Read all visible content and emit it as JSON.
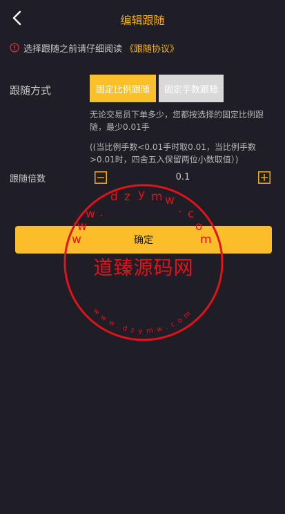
{
  "header": {
    "title": "编辑跟随",
    "back_icon": "chevron-left-icon"
  },
  "notice": {
    "icon": "warning-circle-icon",
    "text": "选择跟随之前请仔细阅读",
    "link": "《跟随协议》"
  },
  "follow_mode": {
    "label": "跟随方式",
    "options": [
      "固定比例跟随",
      "固定手数跟随"
    ],
    "selected": "固定比例跟随",
    "description": "无论交易员下单多少，您都按选择的固定比例跟随，最少0.01手",
    "note": "((当比例手数<0.01手时取0.01，当比例手数>0.01时，四舍五入保留两位小数取值）)"
  },
  "multiplier": {
    "label": "跟随倍数",
    "value": "0.1"
  },
  "confirm_label": "确定",
  "watermark": {
    "main": "道臻源码网",
    "top_letters": [
      "w",
      "w",
      "w",
      ".",
      "d",
      "z",
      "y",
      "m",
      "w",
      ".",
      "c",
      "o",
      "m"
    ],
    "bottom_text": "www.dzymw.com"
  },
  "colors": {
    "accent": "#f2b01e",
    "background": "#1f1e26",
    "stamp": "#e3121a"
  }
}
